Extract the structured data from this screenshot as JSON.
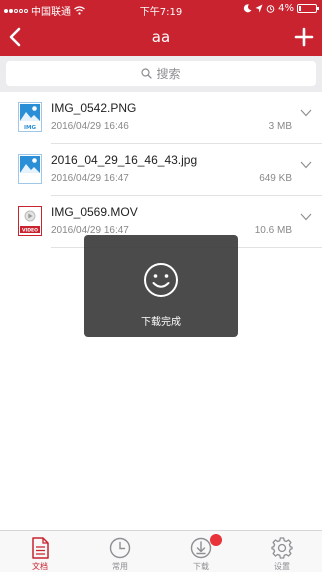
{
  "status_bar": {
    "carrier": "中国联通",
    "time": "下午7:19",
    "battery": "4%"
  },
  "nav": {
    "title": "aa",
    "back_icon": "chevron-left-icon",
    "add_icon": "plus-icon"
  },
  "search": {
    "placeholder": "搜索"
  },
  "files": [
    {
      "name": "IMG_0542.PNG",
      "date": "2016/04/29 16:46",
      "size": "3 MB",
      "icon": "image-file-icon",
      "badge": "IMG"
    },
    {
      "name": "2016_04_29_16_46_43.jpg",
      "date": "2016/04/29 16:47",
      "size": "649 KB",
      "icon": "image-file-icon",
      "badge": ""
    },
    {
      "name": "IMG_0569.MOV",
      "date": "2016/04/29 16:47",
      "size": "10.6 MB",
      "icon": "video-file-icon",
      "badge": "VIDEO"
    }
  ],
  "toast": {
    "message": "下载完成",
    "icon": "smile-icon"
  },
  "tabs": [
    {
      "label": "文档",
      "icon": "document-icon",
      "active": true
    },
    {
      "label": "常用",
      "icon": "clock-icon",
      "active": false
    },
    {
      "label": "下载",
      "icon": "download-icon",
      "active": false,
      "badge": true
    },
    {
      "label": "设置",
      "icon": "gear-icon",
      "active": false
    }
  ],
  "colors": {
    "brand": "#c8232f",
    "badge": "#e8333b",
    "file_icon_blue": "#2a8fd6",
    "video_icon_red": "#c8232f"
  }
}
